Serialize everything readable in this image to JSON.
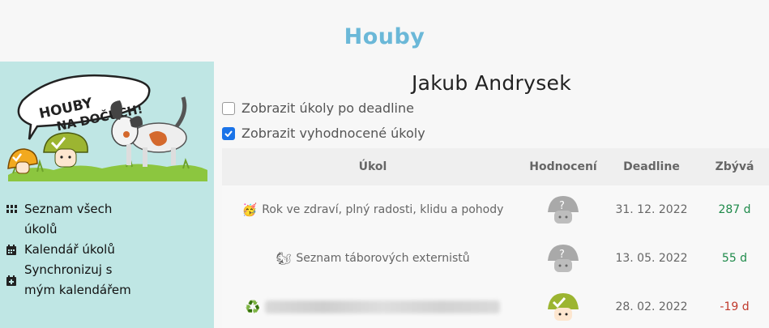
{
  "app": {
    "title": "Houby"
  },
  "logo": {
    "text_line1": "HOUBY",
    "text_line2": "NA DOČUCH!"
  },
  "sidebar": {
    "items": [
      {
        "label": "Seznam všech úkolů",
        "icon": "grid-icon"
      },
      {
        "label": "Kalendář úkolů",
        "icon": "calendar-icon"
      },
      {
        "label": "Synchronizuj s mým kalendářem",
        "icon": "calendar-add-icon"
      }
    ]
  },
  "main": {
    "user_name": "Jakub Andrysek",
    "filters": [
      {
        "label": "Zobrazit úkoly po deadline",
        "checked": false
      },
      {
        "label": "Zobrazit vyhodnocené úkoly",
        "checked": true
      }
    ],
    "table": {
      "headers": [
        "Úkol",
        "Hodnocení",
        "Deadline",
        "Zbývá"
      ],
      "rows": [
        {
          "emoji": "🥳",
          "task": "Rok ve zdraví, plný radosti, klidu a pohody",
          "rating": "unrated",
          "deadline": "31. 12. 2022",
          "remaining": "287 d",
          "status": "positive"
        },
        {
          "emoji": "🐿",
          "task": "Seznam táborových externistů",
          "rating": "unrated",
          "deadline": "13. 05. 2022",
          "remaining": "55 d",
          "status": "positive"
        },
        {
          "emoji": "♻️",
          "task": "",
          "rating": "done",
          "deadline": "28. 02. 2022",
          "remaining": "-19 d",
          "status": "negative"
        }
      ]
    }
  },
  "colors": {
    "title": "#6bb8d8",
    "sidebar_bg": "#bfe6e4",
    "positive": "#1e8a4a",
    "negative": "#c0392b",
    "checkbox": "#1a73e8"
  }
}
